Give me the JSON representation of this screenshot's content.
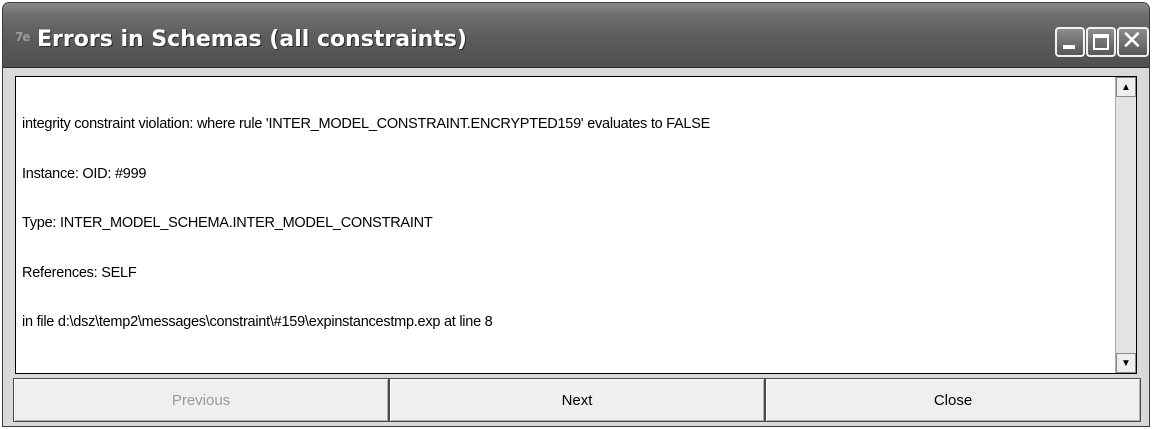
{
  "window": {
    "title": "Errors in Schemas (all constraints)",
    "app_icon": "schema-app-icon"
  },
  "title_buttons": {
    "minimize_icon": "minimize-icon",
    "maximize_icon": "maximize-icon",
    "close_icon": "close-icon",
    "close_glyph": "✕"
  },
  "message": {
    "lines": [
      "integrity constraint violation: where rule 'INTER_MODEL_CONSTRAINT.ENCRYPTED159' evaluates to FALSE",
      "Instance: OID: #999",
      "Type: INTER_MODEL_SCHEMA.INTER_MODEL_CONSTRAINT",
      "References: SELF",
      "in file d:\\dsz\\temp2\\messages\\constraint\\#159\\expinstancestmp.exp at line 8"
    ]
  },
  "scrollbar": {
    "up_icon": "▲",
    "down_icon": "▼"
  },
  "buttons": {
    "previous": "Previous",
    "next": "Next",
    "close": "Close"
  },
  "colors": {
    "titlebar": "#5c5c5c",
    "disabled_text": "#9a9a9a"
  }
}
